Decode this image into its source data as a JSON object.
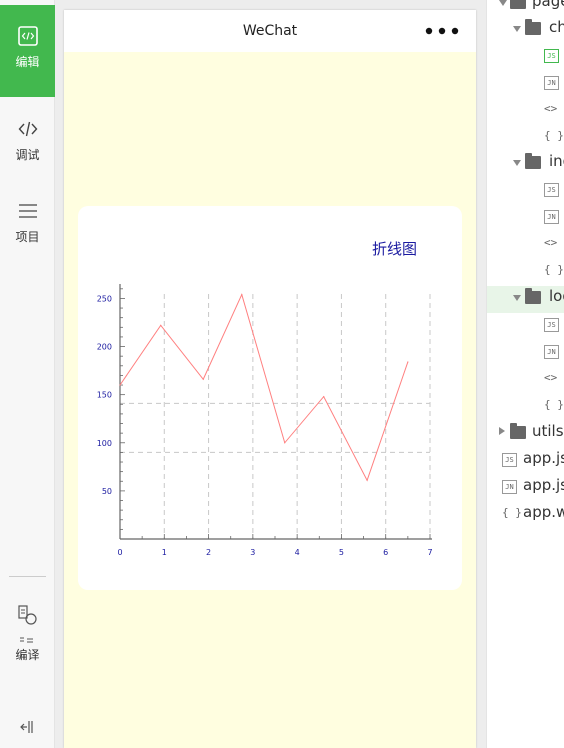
{
  "toolbar": {
    "items": [
      {
        "label": "编辑",
        "icon": "code-icon",
        "active": true
      },
      {
        "label": "调试",
        "icon": "debug-code-icon"
      },
      {
        "label": "项目",
        "icon": "menu-icon"
      },
      {
        "label": "编译",
        "icon": "compile-icon"
      }
    ]
  },
  "simulator": {
    "nav_title": "WeChat",
    "menu_icon": "more-dots-icon",
    "background": "#fffee0"
  },
  "chart_data": {
    "type": "line",
    "title": "折线图",
    "x": [
      0,
      0.92,
      1.88,
      2.75,
      3.72,
      4.6,
      5.58,
      6.5
    ],
    "series": [
      {
        "values": [
          160,
          222,
          166,
          254,
          100,
          148,
          61,
          184
        ],
        "color": "#ff8080"
      }
    ],
    "xticks": [
      "0",
      "1",
      "2",
      "3",
      "4",
      "5",
      "6",
      "7"
    ],
    "yticks": [
      "50",
      "100",
      "150",
      "200",
      "250"
    ],
    "xlim": [
      0,
      7
    ],
    "ylim": [
      0,
      265
    ],
    "grid": true,
    "xlabel": "",
    "ylabel": ""
  },
  "filetree": {
    "rows": [
      {
        "label": "page",
        "kind": "folder",
        "open": true
      },
      {
        "label": "ch",
        "kind": "folder",
        "open": true
      },
      {
        "label": "",
        "kind": "js-active"
      },
      {
        "label": "",
        "kind": "json"
      },
      {
        "label": "",
        "kind": "wxml"
      },
      {
        "label": "",
        "kind": "wxss"
      },
      {
        "label": "ind",
        "kind": "folder",
        "open": true
      },
      {
        "label": "",
        "kind": "js"
      },
      {
        "label": "",
        "kind": "json"
      },
      {
        "label": "",
        "kind": "wxml"
      },
      {
        "label": "",
        "kind": "wxss"
      },
      {
        "label": "log",
        "kind": "folder",
        "open": true,
        "selected": true
      },
      {
        "label": "",
        "kind": "js"
      },
      {
        "label": "",
        "kind": "json"
      },
      {
        "label": "",
        "kind": "wxml"
      },
      {
        "label": "",
        "kind": "wxss"
      },
      {
        "label": "utils",
        "kind": "folder",
        "open": false
      },
      {
        "label": "app.js",
        "kind": "js"
      },
      {
        "label": "app.js",
        "kind": "json"
      },
      {
        "label": "app.w",
        "kind": "wxss"
      }
    ]
  }
}
